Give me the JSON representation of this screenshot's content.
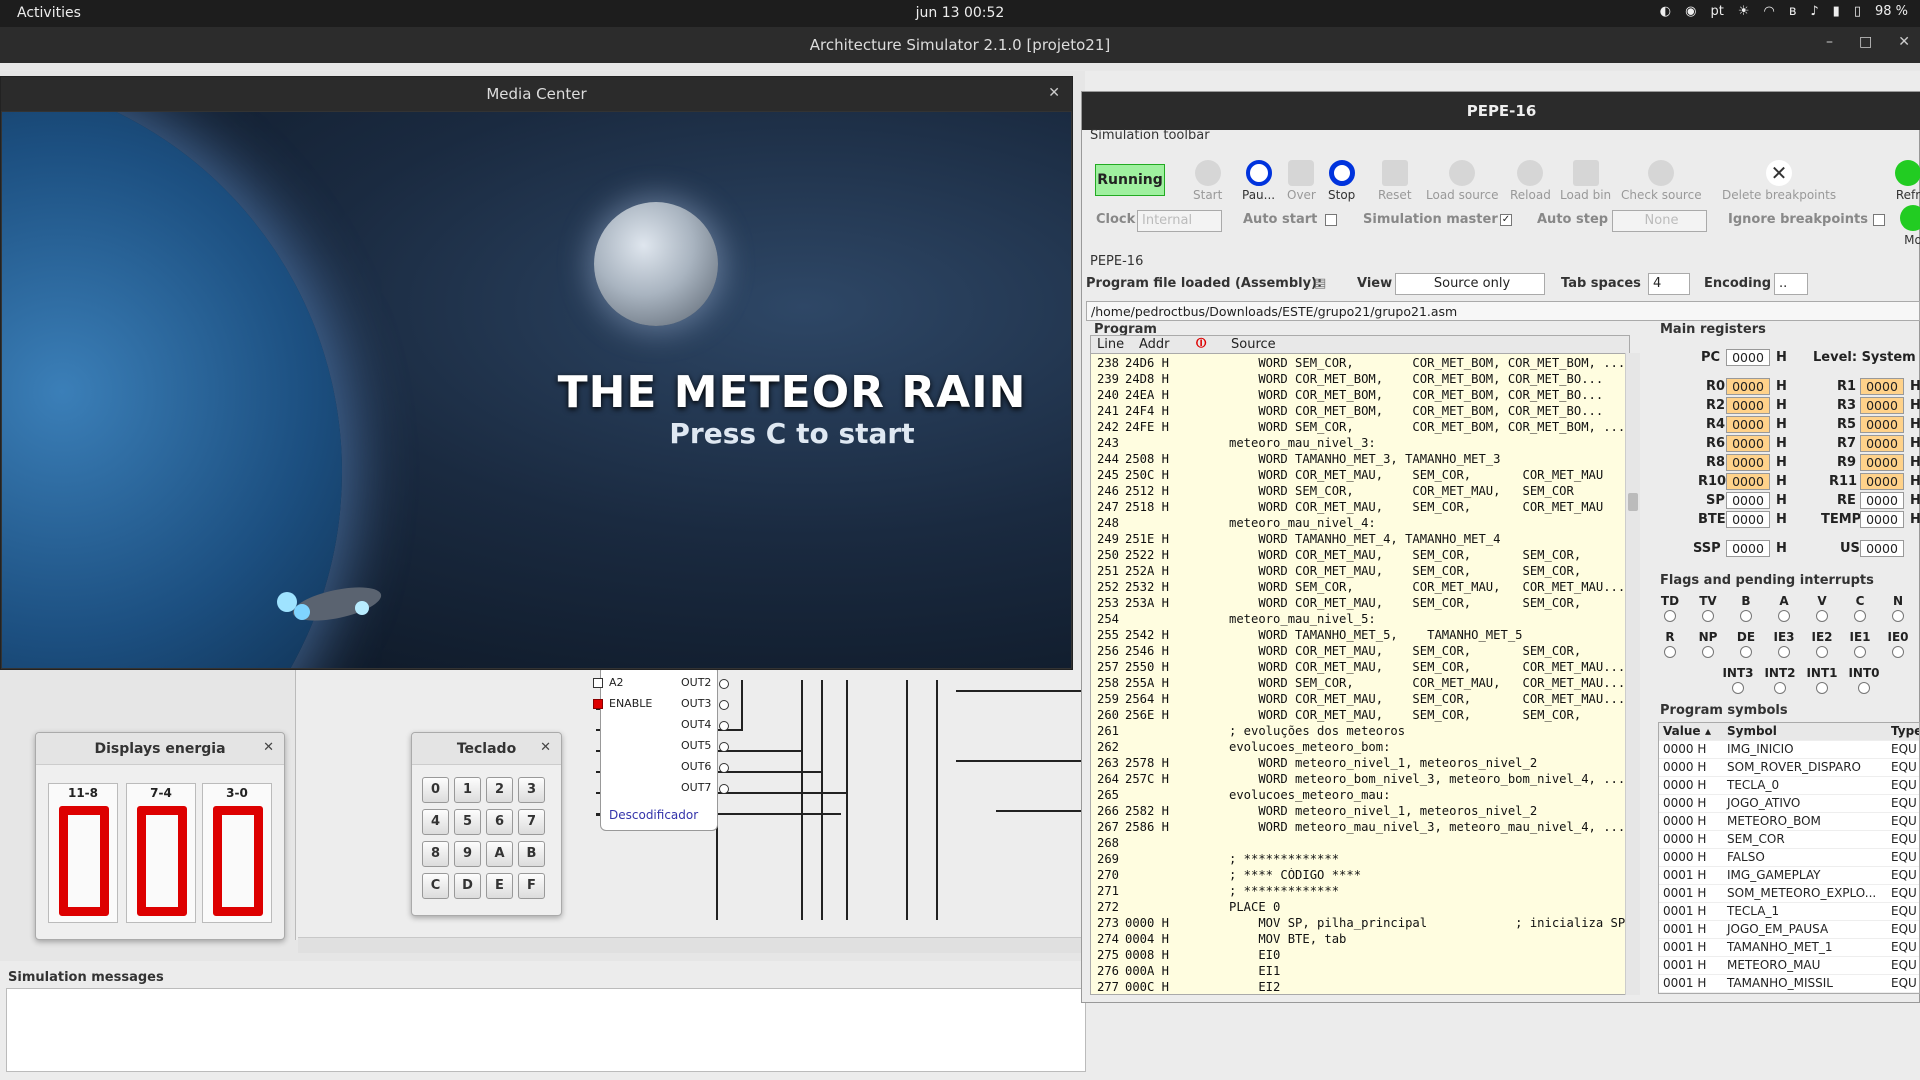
{
  "topbar": {
    "activities": "Activities",
    "clock": "jun 13  00:52",
    "lang": "pt",
    "battery": "98 %"
  },
  "app": {
    "title": "Architecture Simulator 2.1.0 [projeto21]"
  },
  "media": {
    "title": "Media Center",
    "game_title": "THE METEOR RAIN",
    "game_sub": "Press C to start"
  },
  "displays": {
    "title": "Displays energia",
    "labels": [
      "11-8",
      "7-4",
      "3-0"
    ]
  },
  "keypad": {
    "title": "Teclado",
    "keys": [
      "0",
      "1",
      "2",
      "3",
      "4",
      "5",
      "6",
      "7",
      "8",
      "9",
      "A",
      "B",
      "C",
      "D",
      "E",
      "F"
    ]
  },
  "decoder": {
    "pins_left": [
      "A2",
      "ENABLE"
    ],
    "pins_right": [
      "OUT2",
      "OUT3",
      "OUT4",
      "OUT5",
      "OUT6",
      "OUT7"
    ],
    "label": "Descodificador"
  },
  "messages": {
    "title": "Simulation messages"
  },
  "pepe": {
    "title": "PEPE-16",
    "toolbar_title": "Simulation toolbar",
    "status": "Running",
    "buttons": [
      "Start",
      "Pau...",
      "Over",
      "Stop",
      "Reset",
      "Load source",
      "Reload",
      "Load bin",
      "Check source",
      "Delete breakpoints",
      "Refr",
      "Mo"
    ],
    "clock_label": "Clock",
    "clock_value": "Internal",
    "auto_start": "Auto start",
    "sim_master": "Simulation master",
    "auto_step": "Auto step",
    "auto_step_value": "None",
    "ignore_bp": "Ignore breakpoints",
    "section": "PEPE-16",
    "prog_loaded": "Program file loaded (Assembly):",
    "view_label": "View",
    "view_value": "Source only",
    "tab_label": "Tab spaces",
    "tab_value": "4",
    "enc_label": "Encoding",
    "enc_value": "..",
    "path": "/home/pedroctbus/Downloads/ESTE/grupo21/grupo21.asm",
    "program_label": "Program",
    "cols": [
      "Line",
      "Addr",
      "Source"
    ],
    "lines": [
      [
        "238",
        "24D6 H",
        "    WORD SEM_COR,        COR_MET_BOM, COR_MET_BOM, ..."
      ],
      [
        "239",
        "24D8 H",
        "    WORD COR_MET_BOM,    COR_MET_BOM, COR_MET_BO..."
      ],
      [
        "240",
        "24EA H",
        "    WORD COR_MET_BOM,    COR_MET_BOM, COR_MET_BO..."
      ],
      [
        "241",
        "24F4 H",
        "    WORD COR_MET_BOM,    COR_MET_BOM, COR_MET_BO..."
      ],
      [
        "242",
        "24FE H",
        "    WORD SEM_COR,        COR_MET_BOM, COR_MET_BOM, ..."
      ],
      [
        "243",
        "",
        "meteoro_mau_nivel_3:"
      ],
      [
        "244",
        "2508 H",
        "    WORD TAMANHO_MET_3, TAMANHO_MET_3"
      ],
      [
        "245",
        "250C H",
        "    WORD COR_MET_MAU,    SEM_COR,       COR_MET_MAU"
      ],
      [
        "246",
        "2512 H",
        "    WORD SEM_COR,        COR_MET_MAU,   SEM_COR"
      ],
      [
        "247",
        "2518 H",
        "    WORD COR_MET_MAU,    SEM_COR,       COR_MET_MAU"
      ],
      [
        "248",
        "",
        "meteoro_mau_nivel_4:"
      ],
      [
        "249",
        "251E H",
        "    WORD TAMANHO_MET_4, TAMANHO_MET_4"
      ],
      [
        "250",
        "2522 H",
        "    WORD COR_MET_MAU,    SEM_COR,       SEM_COR,       ..."
      ],
      [
        "251",
        "252A H",
        "    WORD COR_MET_MAU,    SEM_COR,       SEM_COR,       ..."
      ],
      [
        "252",
        "2532 H",
        "    WORD SEM_COR,        COR_MET_MAU,   COR_MET_MAU..."
      ],
      [
        "253",
        "253A H",
        "    WORD COR_MET_MAU,    SEM_COR,       SEM_COR,       ..."
      ],
      [
        "254",
        "",
        "meteoro_mau_nivel_5:"
      ],
      [
        "255",
        "2542 H",
        "    WORD TAMANHO_MET_5,    TAMANHO_MET_5"
      ],
      [
        "256",
        "2546 H",
        "    WORD COR_MET_MAU,    SEM_COR,       SEM_COR,       ..."
      ],
      [
        "257",
        "2550 H",
        "    WORD COR_MET_MAU,    SEM_COR,       COR_MET_MAU..."
      ],
      [
        "258",
        "255A H",
        "    WORD SEM_COR,        COR_MET_MAU,   COR_MET_MAU..."
      ],
      [
        "259",
        "2564 H",
        "    WORD COR_MET_MAU,    SEM_COR,       COR_MET_MAU..."
      ],
      [
        "260",
        "256E H",
        "    WORD COR_MET_MAU,    SEM_COR,       SEM_COR,       ..."
      ],
      [
        "261",
        "",
        "; evoluções dos meteoros"
      ],
      [
        "262",
        "",
        "evolucoes_meteoro_bom:"
      ],
      [
        "263",
        "2578 H",
        "    WORD meteoro_nivel_1, meteoros_nivel_2"
      ],
      [
        "264",
        "257C H",
        "    WORD meteoro_bom_nivel_3, meteoro_bom_nivel_4, ..."
      ],
      [
        "265",
        "",
        "evolucoes_meteoro_mau:"
      ],
      [
        "266",
        "2582 H",
        "    WORD meteoro_nivel_1, meteoros_nivel_2"
      ],
      [
        "267",
        "2586 H",
        "    WORD meteoro_mau_nivel_3, meteoro_mau_nivel_4, ..."
      ],
      [
        "268",
        "",
        ""
      ],
      [
        "269",
        "",
        "; *************"
      ],
      [
        "270",
        "",
        "; **** CÓDIGO ****"
      ],
      [
        "271",
        "",
        "; *************"
      ],
      [
        "272",
        "",
        "PLACE 0"
      ],
      [
        "273",
        "0000 H",
        "    MOV SP, pilha_principal            ; inicializa SP para ..."
      ],
      [
        "274",
        "0004 H",
        "    MOV BTE, tab"
      ],
      [
        "275",
        "0008 H",
        "    EI0"
      ],
      [
        "276",
        "000A H",
        "    EI1"
      ],
      [
        "277",
        "000C H",
        "    EI2"
      ]
    ],
    "main_registers": "Main registers",
    "pc": {
      "label": "PC",
      "value": "0000"
    },
    "level": "Level: System",
    "regs_left": [
      [
        "R0",
        "0000"
      ],
      [
        "R2",
        "0000"
      ],
      [
        "R4",
        "0000"
      ],
      [
        "R6",
        "0000"
      ],
      [
        "R8",
        "0000"
      ],
      [
        "R10",
        "0000"
      ],
      [
        "SP",
        "0000"
      ],
      [
        "BTE",
        "0000"
      ]
    ],
    "regs_right": [
      [
        "R1",
        "0000"
      ],
      [
        "R3",
        "0000"
      ],
      [
        "R5",
        "0000"
      ],
      [
        "R7",
        "0000"
      ],
      [
        "R9",
        "0000"
      ],
      [
        "R11",
        "0000"
      ],
      [
        "RE",
        "0000"
      ],
      [
        "TEMP",
        "0000"
      ]
    ],
    "ssp": {
      "label": "SSP",
      "value": "0000"
    },
    "usp": {
      "label": "USP",
      "value": "0000"
    },
    "h": "H",
    "flags_title": "Flags and pending interrupts",
    "flags1": [
      "TD",
      "TV",
      "B",
      "A",
      "V",
      "C",
      "N"
    ],
    "flags2": [
      "R",
      "NP",
      "DE",
      "IE3",
      "IE2",
      "IE1",
      "IE0"
    ],
    "flags3": [
      "INT3",
      "INT2",
      "INT1",
      "INT0"
    ],
    "symbols_title": "Program symbols",
    "sym_cols": [
      "Value",
      "Symbol",
      "Type"
    ],
    "symbols": [
      [
        "0000 H",
        "IMG_INICIO",
        "EQU"
      ],
      [
        "0000 H",
        "SOM_ROVER_DISPARO",
        "EQU"
      ],
      [
        "0000 H",
        "TECLA_0",
        "EQU"
      ],
      [
        "0000 H",
        "JOGO_ATIVO",
        "EQU"
      ],
      [
        "0000 H",
        "METEORO_BOM",
        "EQU"
      ],
      [
        "0000 H",
        "SEM_COR",
        "EQU"
      ],
      [
        "0000 H",
        "FALSO",
        "EQU"
      ],
      [
        "0001 H",
        "IMG_GAMEPLAY",
        "EQU"
      ],
      [
        "0001 H",
        "SOM_METEORO_EXPLO...",
        "EQU"
      ],
      [
        "0001 H",
        "TECLA_1",
        "EQU"
      ],
      [
        "0001 H",
        "JOGO_EM_PAUSA",
        "EQU"
      ],
      [
        "0001 H",
        "TAMANHO_MET_1",
        "EQU"
      ],
      [
        "0001 H",
        "METEORO_MAU",
        "EQU"
      ],
      [
        "0001 H",
        "TAMANHO_MISSIL",
        "EQU"
      ]
    ]
  }
}
